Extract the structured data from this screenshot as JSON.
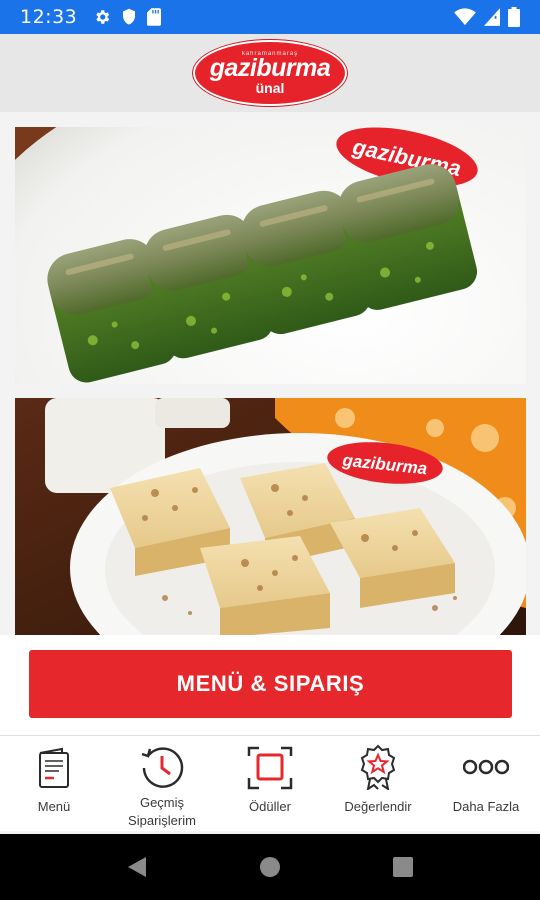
{
  "status_bar": {
    "time": "12:33",
    "left_icons": [
      "gear-icon",
      "shield-icon",
      "sd-card-icon"
    ],
    "right_icons": [
      "wifi-icon",
      "signal-icon",
      "battery-icon"
    ],
    "color": "#1a73e8"
  },
  "header": {
    "logo": {
      "small_text": "kahramanmaraş",
      "main_text": "gaziburma",
      "sub_text": "ünal"
    },
    "background": "#e7e7e7"
  },
  "content": {
    "images": [
      {
        "name": "pistachio-baklava-photo",
        "depicts": "pistachio sarma baklava rolls on a plate"
      },
      {
        "name": "walnut-baklava-photo",
        "depicts": "walnut baklava squares on a plate with ayran"
      }
    ]
  },
  "order_button": {
    "label": "MENÜ & SIPARIŞ",
    "color": "#e6282d"
  },
  "bottom_nav": {
    "items": [
      {
        "label": "Menü",
        "icon": "menu-book-icon"
      },
      {
        "label": "Geçmiş\nSiparişlerim",
        "icon": "history-icon"
      },
      {
        "label": "Ödüller",
        "icon": "rewards-icon"
      },
      {
        "label": "Değerlendir",
        "icon": "rate-badge-icon"
      },
      {
        "label": "Daha Fazla",
        "icon": "more-icon"
      }
    ]
  },
  "android_nav": {
    "buttons": [
      "back-icon",
      "home-icon",
      "recents-icon"
    ]
  }
}
